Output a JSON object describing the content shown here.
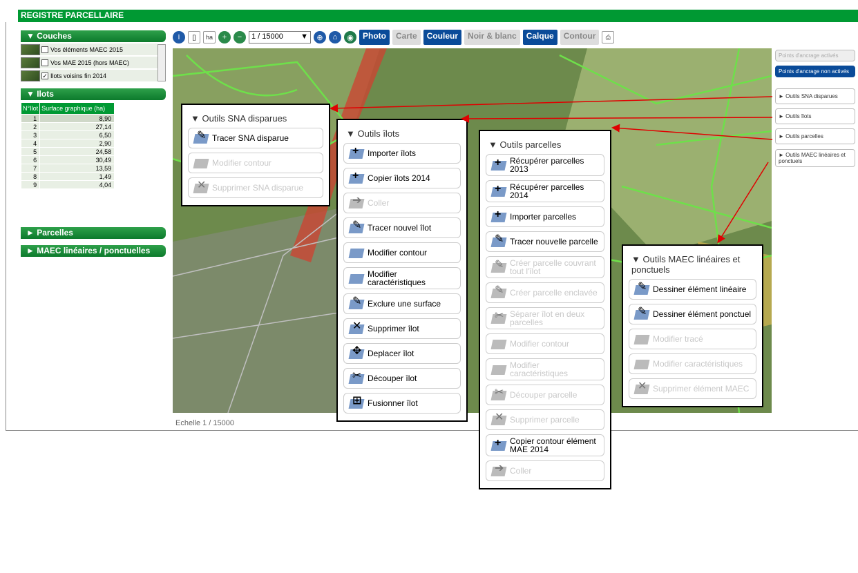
{
  "app_title": "REGISTRE PARCELLAIRE",
  "left": {
    "couches_header": "▼ Couches",
    "layers": [
      {
        "label": "Vos éléments MAEC 2015",
        "checked": false
      },
      {
        "label": "Vos MAE 2015 (hors MAEC)",
        "checked": false
      },
      {
        "label": "Ilots voisins fin 2014",
        "checked": true
      }
    ],
    "ilots_header": "▼ Ilots",
    "table_headers": [
      "N°Ilot",
      "Surface graphique (ha)"
    ],
    "rows": [
      [
        "1",
        "8,90"
      ],
      [
        "2",
        "27,14"
      ],
      [
        "3",
        "6,50"
      ],
      [
        "4",
        "2,90"
      ],
      [
        "5",
        "24,58"
      ],
      [
        "6",
        "30,49"
      ],
      [
        "7",
        "13,59"
      ],
      [
        "8",
        "1,49"
      ],
      [
        "9",
        "4,04"
      ]
    ],
    "parcelles_header": "► Parcelles",
    "maec_header": "► MAEC linéaires / ponctuelles"
  },
  "toolbar": {
    "scale_value": "1 / 15000",
    "photo": "Photo",
    "carte": "Carte",
    "couleur": "Couleur",
    "noir_blanc": "Noir & blanc",
    "calque": "Calque",
    "contour": "Contour",
    "ha": "ha"
  },
  "map": {
    "scale_text": "Echelle 1 / 15000"
  },
  "right": {
    "ancrage_on": "Points d'ancrage activés",
    "ancrage_off": "Points d'ancrage non activés",
    "sna": "► Outils SNA disparues",
    "ilots": "► Outils îlots",
    "parcelles": "► Outils parcelles",
    "maec": "► Outils MAEC linéaires et ponctuels"
  },
  "panels": {
    "sna": {
      "title": "▼ Outils SNA disparues",
      "tools": [
        {
          "label": "Tracer SNA disparue",
          "enabled": true,
          "icon": "pencil-icon"
        },
        {
          "label": "Modifier contour",
          "enabled": false,
          "icon": "edit-shape-icon"
        },
        {
          "label": "Supprimer SNA disparue",
          "enabled": false,
          "icon": "delete-icon"
        }
      ]
    },
    "ilots": {
      "title": "▼ Outils îlots",
      "tools": [
        {
          "label": "Importer îlots",
          "enabled": true,
          "icon": "plus-icon"
        },
        {
          "label": "Copier îlots 2014",
          "enabled": true,
          "icon": "plus-icon"
        },
        {
          "label": "Coller",
          "enabled": false,
          "icon": "paste-icon"
        },
        {
          "label": "Tracer nouvel îlot",
          "enabled": true,
          "icon": "pencil-icon"
        },
        {
          "label": "Modifier contour",
          "enabled": true,
          "icon": "edit-shape-icon"
        },
        {
          "label": "Modifier caractéristiques",
          "enabled": true,
          "icon": "edit-shape-icon"
        },
        {
          "label": "Exclure une surface",
          "enabled": true,
          "icon": "pencil-icon"
        },
        {
          "label": "Supprimer îlot",
          "enabled": true,
          "icon": "delete-icon"
        },
        {
          "label": "Deplacer îlot",
          "enabled": true,
          "icon": "move-icon"
        },
        {
          "label": "Découper îlot",
          "enabled": true,
          "icon": "cut-icon"
        },
        {
          "label": "Fusionner îlot",
          "enabled": true,
          "icon": "merge-icon"
        }
      ]
    },
    "parcelles": {
      "title": "▼ Outils parcelles",
      "tools": [
        {
          "label": "Récupérer parcelles 2013",
          "enabled": true,
          "icon": "plus-icon"
        },
        {
          "label": "Récupérer parcelles 2014",
          "enabled": true,
          "icon": "plus-icon"
        },
        {
          "label": "Importer parcelles",
          "enabled": true,
          "icon": "plus-icon"
        },
        {
          "label": "Tracer nouvelle parcelle",
          "enabled": true,
          "icon": "pencil-icon"
        },
        {
          "label": "Créer parcelle couvrant tout l'îlot",
          "enabled": false,
          "icon": "pencil-icon"
        },
        {
          "label": "Créer parcelle enclavée",
          "enabled": false,
          "icon": "pencil-icon"
        },
        {
          "label": "Séparer îlot en deux parcelles",
          "enabled": false,
          "icon": "cut-icon"
        },
        {
          "label": "Modifier contour",
          "enabled": false,
          "icon": "edit-shape-icon"
        },
        {
          "label": "Modifier caractéristiques",
          "enabled": false,
          "icon": "edit-shape-icon"
        },
        {
          "label": "Découper parcelle",
          "enabled": false,
          "icon": "cut-icon"
        },
        {
          "label": "Supprimer parcelle",
          "enabled": false,
          "icon": "delete-icon"
        },
        {
          "label": "Copier contour élément MAE 2014",
          "enabled": true,
          "icon": "plus-icon"
        },
        {
          "label": "Coller",
          "enabled": false,
          "icon": "paste-icon"
        }
      ]
    },
    "maec": {
      "title": "▼ Outils MAEC linéaires et ponctuels",
      "tools": [
        {
          "label": "Dessiner élément linéaire",
          "enabled": true,
          "icon": "pencil-icon"
        },
        {
          "label": "Dessiner élément ponctuel",
          "enabled": true,
          "icon": "pencil-icon"
        },
        {
          "label": "Modifier tracé",
          "enabled": false,
          "icon": "edit-shape-icon"
        },
        {
          "label": "Modifier caractéristiques",
          "enabled": false,
          "icon": "edit-shape-icon"
        },
        {
          "label": "Supprimer élément MAEC",
          "enabled": false,
          "icon": "delete-icon"
        }
      ]
    }
  }
}
